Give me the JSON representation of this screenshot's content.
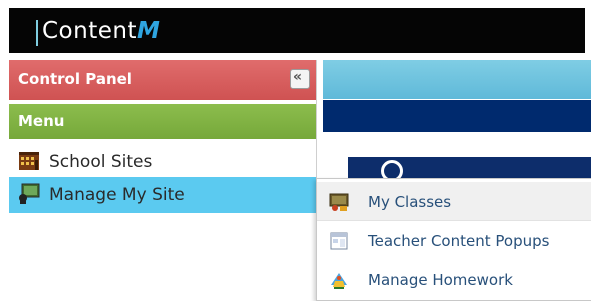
{
  "app": {
    "logo_text": "Content",
    "logo_m": "M"
  },
  "sidebar": {
    "control_panel_title": "Control Panel",
    "collapse_glyph": "«",
    "menu_title": "Menu",
    "items": [
      {
        "label": "School Sites",
        "icon": "school-building-icon"
      },
      {
        "label": "Manage My Site",
        "icon": "manage-site-icon",
        "active": true
      }
    ]
  },
  "popup_menu": {
    "items": [
      {
        "label": "My Classes",
        "icon": "classes-icon",
        "hover": true
      },
      {
        "label": "Teacher Content Popups",
        "icon": "content-popups-icon"
      },
      {
        "label": "Manage Homework",
        "icon": "homework-icon"
      }
    ]
  },
  "colors": {
    "control_panel_header": "#d65b5b",
    "menu_header": "#82b444",
    "active_item": "#5bcaf0",
    "link_text": "#28507a",
    "top_band": "#6fc3df",
    "navy_band": "#002a6e"
  }
}
